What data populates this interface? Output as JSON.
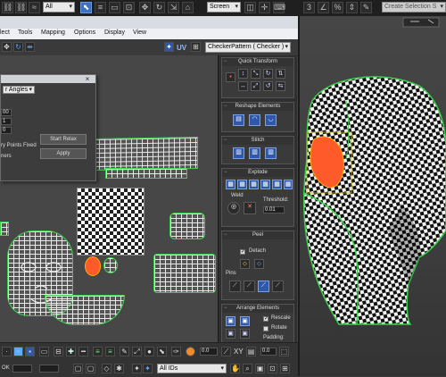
{
  "top_toolbar": {
    "selection_filter": "All",
    "coordinate_system": "Screen",
    "named_selection_placeholder": "Create Selection S"
  },
  "unwrap_window": {
    "menu": [
      "lect",
      "Tools",
      "Mapping",
      "Options",
      "Display",
      "View"
    ],
    "uv_label": "UV",
    "texture_dropdown": "CheckerPattern  ( Checker )",
    "relax_dialog": {
      "method": "r Angles",
      "iterations": "00",
      "amount": "1",
      "stretch": "0",
      "keep_points_label": "ry Points Fixed",
      "extra_label": "ners",
      "start_relax_label": "Start Relax",
      "apply_label": "Apply"
    },
    "rollouts": {
      "quick_transform": {
        "title": "Quick Transform"
      },
      "reshape": {
        "title": "Reshape Elements"
      },
      "stitch": {
        "title": "Stitch"
      },
      "explode": {
        "title": "Explode",
        "weld_label": "Weld",
        "threshold_label": "Threshold:",
        "threshold_value": "0.01"
      },
      "peel": {
        "title": "Peel",
        "detach_label": "Detach",
        "pins_label": "Pins"
      },
      "arrange": {
        "title": "Arrange Elements",
        "rescale_label": "Rescale",
        "rotate_label": "Rotate",
        "padding_label": "Padding:"
      }
    },
    "bottom_toolbar": {
      "value_field_1": "0.0",
      "value_field_2": "0.0",
      "xy_label": "XY",
      "ids_dropdown": "All IDs",
      "bottom_left_label": "OK"
    }
  }
}
